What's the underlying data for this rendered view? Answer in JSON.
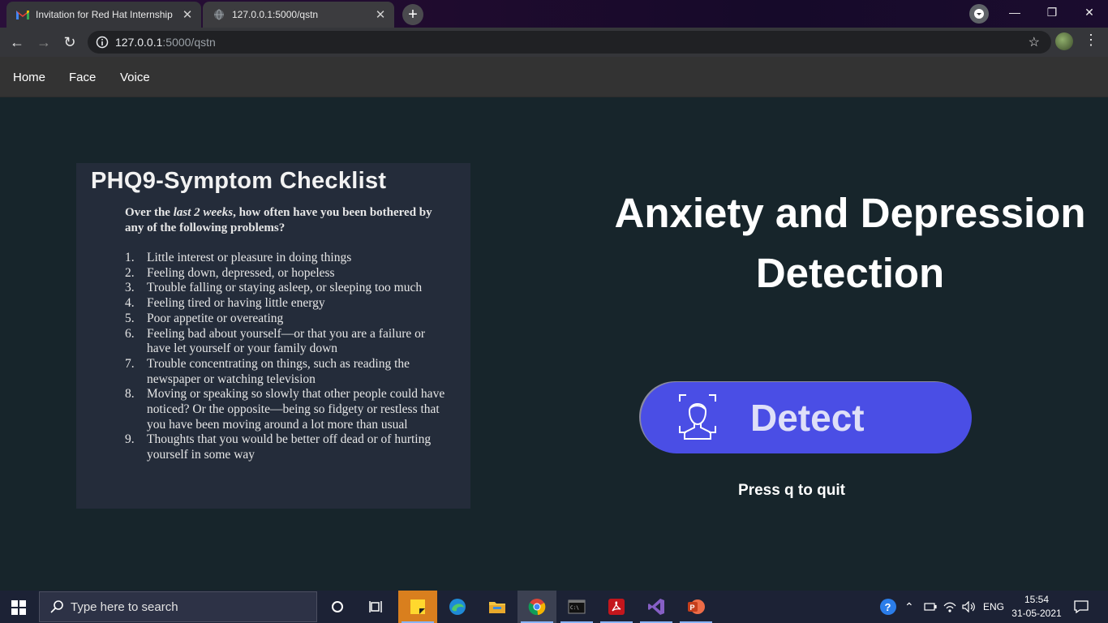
{
  "browser": {
    "tabs": [
      {
        "title": "Invitation for Red Hat Internship",
        "icon": "gmail-icon"
      },
      {
        "title": "127.0.0.1:5000/qstn",
        "icon": "globe-icon"
      }
    ],
    "url_host": "127.0.0.1",
    "url_path": ":5000/qstn",
    "new_tab": "+",
    "minimize": "—",
    "restore": "❐",
    "close": "✕"
  },
  "site_nav": {
    "items": [
      {
        "label": "Home"
      },
      {
        "label": "Face"
      },
      {
        "label": "Voice"
      }
    ]
  },
  "checklist": {
    "title": "PHQ9-Symptom Checklist",
    "intro_before": "Over the ",
    "intro_em": "last 2 weeks",
    "intro_after": ", how often have you been bothered by any of the following problems?",
    "items": [
      {
        "num": "1.",
        "text": "Little interest or pleasure in doing things"
      },
      {
        "num": "2.",
        "text": "Feeling down, depressed, or hopeless"
      },
      {
        "num": "3.",
        "text": "Trouble falling or staying asleep, or sleeping too much"
      },
      {
        "num": "4.",
        "text": "Feeling tired or having little energy"
      },
      {
        "num": "5.",
        "text": "Poor appetite or overeating"
      },
      {
        "num": "6.",
        "text": "Feeling bad about yourself—or that you are a failure or have let yourself or your family down"
      },
      {
        "num": "7.",
        "text": "Trouble concentrating on things, such as reading the newspaper or watching television"
      },
      {
        "num": "8.",
        "text": "Moving or speaking so slowly that other people could have noticed? Or the opposite—being so fidgety or restless that you have been moving around a lot more than usual"
      },
      {
        "num": "9.",
        "text": "Thoughts that you would be better off dead or of hurting yourself in some way"
      }
    ]
  },
  "main": {
    "headline": "Anxiety and Depression Detection",
    "detect_label": "Detect",
    "quit_hint": "Press q to quit"
  },
  "taskbar": {
    "search_placeholder": "Type here to search",
    "language": "ENG",
    "time": "15:54",
    "date": "31-05-2021",
    "apps": [
      "cortana-icon",
      "task-view-icon",
      "sticky-notes-icon",
      "edge-icon",
      "file-explorer-icon",
      "chrome-icon",
      "terminal-icon",
      "acrobat-icon",
      "visual-studio-icon",
      "powerpoint-icon"
    ]
  },
  "colors": {
    "page_bg": "#17252b",
    "nav_bg": "#333333",
    "button_bg": "#4a4ee5",
    "checklist_bg": "#242c3a"
  }
}
